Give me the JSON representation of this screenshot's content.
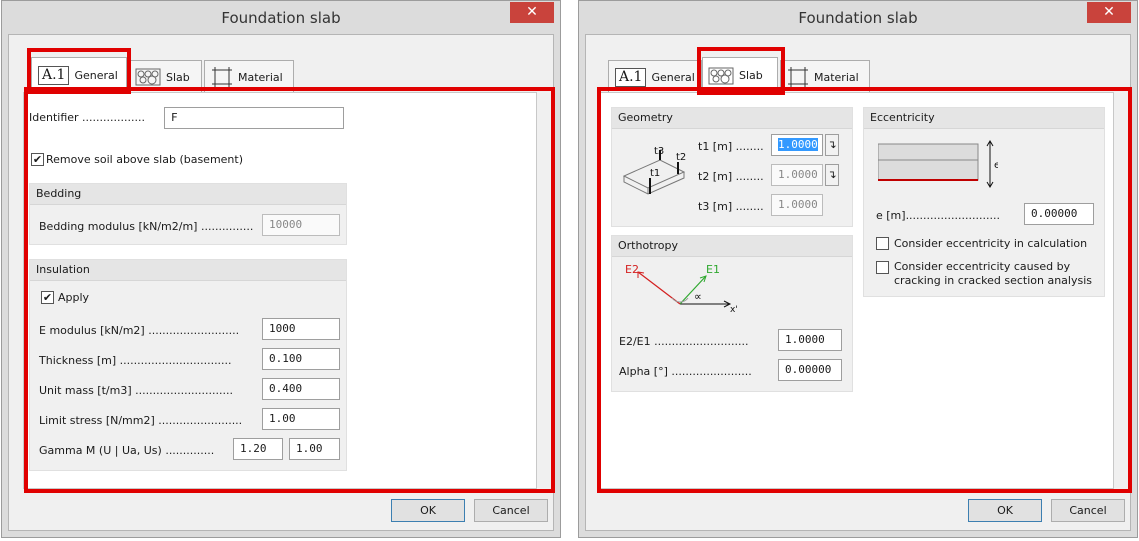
{
  "window_title": "Foundation slab",
  "close_glyph": "✕",
  "tabs": {
    "general": {
      "badge": "A.1",
      "label": "General"
    },
    "slab": {
      "label": "Slab"
    },
    "material": {
      "label": "Material"
    }
  },
  "general": {
    "identifier": {
      "label": "Identifier ..................",
      "value": "F"
    },
    "remove_soil": {
      "label": "Remove soil above slab (basement)",
      "checked": true
    },
    "bedding": {
      "title": "Bedding",
      "modulus": {
        "label": "Bedding modulus [kN/m2/m] ...............",
        "value": "10000"
      }
    },
    "insulation": {
      "title": "Insulation",
      "apply": {
        "label": "Apply",
        "checked": true
      },
      "e_modulus": {
        "label": "E modulus [kN/m2] ..........................",
        "value": "1000"
      },
      "thickness": {
        "label": "Thickness [m] ................................",
        "value": "0.100"
      },
      "unit_mass": {
        "label": "Unit mass [t/m3] ............................",
        "value": "0.400"
      },
      "limit_stress": {
        "label": "Limit stress [N/mm2] ........................",
        "value": "1.00"
      },
      "gamma_m": {
        "label": "Gamma M (U | Ua, Us) ..............",
        "value1": "1.20",
        "value2": "1.00"
      }
    }
  },
  "slab": {
    "geometry": {
      "title": "Geometry",
      "diagram_labels": {
        "t1": "t1",
        "t2": "t2",
        "t3": "t3"
      },
      "t1": {
        "label": "t1 [m] ........",
        "value": "1.0000"
      },
      "t2": {
        "label": "t2 [m] ........",
        "value": "1.0000"
      },
      "t3": {
        "label": "t3 [m] ........",
        "value": "1.0000"
      }
    },
    "eccentricity": {
      "title": "Eccentricity",
      "diagram_label": "e",
      "e": {
        "label": "e [m]...........................",
        "value": "0.00000"
      },
      "consider_calc": {
        "label": "Consider eccentricity in calculation",
        "checked": false
      },
      "consider_cracking": {
        "label": "Consider eccentricity caused by cracking in cracked section analysis",
        "checked": false
      }
    },
    "orthotropy": {
      "title": "Orthotropy",
      "diagram_labels": {
        "e1": "E1",
        "e2": "E2",
        "alpha": "∝",
        "x": "x'"
      },
      "e2e1": {
        "label": "E2/E1 ...........................",
        "value": "1.0000"
      },
      "alpha": {
        "label": "Alpha [°] .......................",
        "value": "0.00000"
      }
    }
  },
  "buttons": {
    "ok": "OK",
    "cancel": "Cancel"
  },
  "colors": {
    "highlight": "#e00000",
    "close_button": "#c9433c",
    "e1_arrow": "#2fa82f",
    "e2_arrow": "#d42020"
  }
}
